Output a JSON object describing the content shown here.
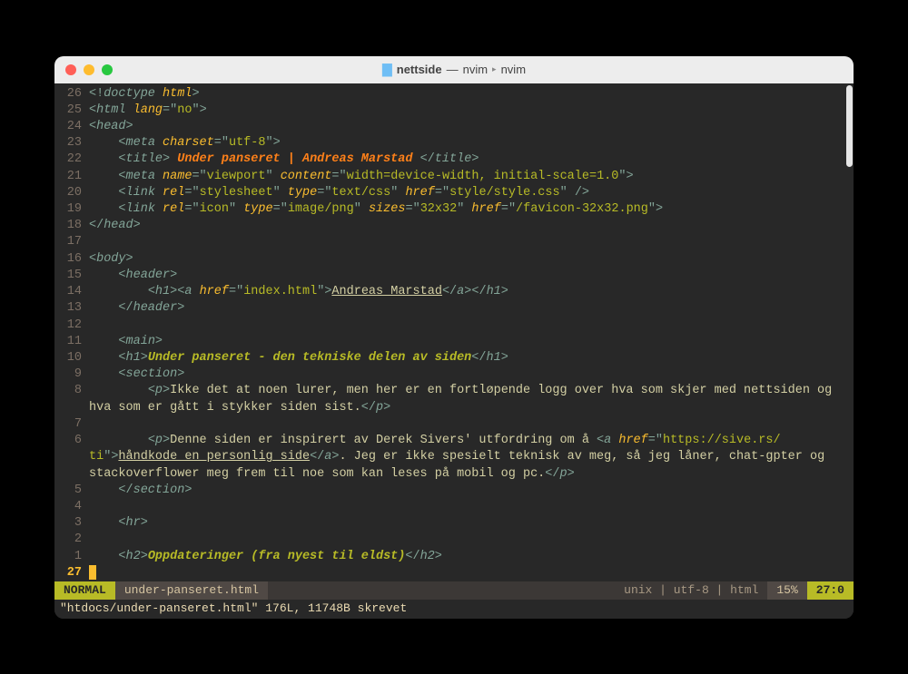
{
  "title": {
    "folder": "nettside",
    "proc": "nvim",
    "sub": "nvim"
  },
  "linenos": {
    "l0": "26",
    "l1": "25",
    "l2": "24",
    "l3": "23",
    "l4": "22",
    "l5": "21",
    "l6": "20",
    "l7": "19",
    "l8": "18",
    "l9": "17",
    "l10": "16",
    "l11": "15",
    "l12": "14",
    "l13": "13",
    "l14": "12",
    "l15": "11",
    "l16": "10",
    "l17": "9",
    "l18": "8",
    "l19": "7",
    "l20": "6",
    "l21": "5",
    "l22": "4",
    "l23": "3",
    "l24": "2",
    "l25": "1",
    "cur": "27"
  },
  "code": {
    "doctype_open": "<!",
    "doctype": "doctype",
    "html_kw": "html",
    "doctype_close": ">",
    "open": "<",
    "close": ">",
    "slash_open": "</",
    "self_close": "/>",
    "eq": "=",
    "q": "\"",
    "t_html": "html",
    "t_head": "head",
    "t_meta": "meta",
    "t_title": "title",
    "t_link": "link",
    "t_body": "body",
    "t_header": "header",
    "t_h1": "h1",
    "t_a": "a",
    "t_main": "main",
    "t_section": "section",
    "t_p": "p",
    "t_hr": "hr",
    "t_h2": "h2",
    "a_lang": "lang",
    "v_lang": "no",
    "a_charset": "charset",
    "v_charset": "utf-8",
    "txt_title": " Under panseret | Andreas Marstad ",
    "a_name": "name",
    "v_viewport": "viewport",
    "a_content": "content",
    "v_vpcont": "width=device-width, initial-scale=1.0",
    "a_rel": "rel",
    "v_stylesheet": "stylesheet",
    "a_type": "type",
    "v_textcss": "text/css",
    "a_href": "href",
    "v_stylehref": "style/style.css",
    "v_icon": "icon",
    "v_imgpng": "image/png",
    "a_sizes": "sizes",
    "v_sizes": "32x32",
    "v_favicon": "/favicon-32x32.png",
    "v_index": "index.html",
    "txt_am": "Andreas Marstad",
    "txt_h1": "Under panseret - den tekniske delen av siden",
    "p1_a": "Ikke det at noen lurer, men her er en fortløpende logg over hva som skjer med nettsiden og ",
    "p1_b": "hva som er gått i stykker siden sist.",
    "p2_a": "Denne siden er inspirert av Derek Sivers' utfordring om å ",
    "v_sivers": "https://sive.rs/",
    "p2_b": "ti",
    "p2_link": "håndkode en personlig side",
    "p2_c": ". Jeg er ikke spesielt teknisk av meg, så jeg låner, chat-gpter og ",
    "p2_d": "stackoverflower meg frem til noe som kan leses på mobil og pc.",
    "txt_h2": "Oppdateringer (fra nyest til eldst)",
    "ind1": "    ",
    "ind2": "        ",
    "ind3": "            "
  },
  "status": {
    "mode": "NORMAL",
    "file": "under-panseret.html",
    "filetype": "unix | utf-8 | html",
    "percent": "15%",
    "pos": "27:0"
  },
  "message": "\"htdocs/under-panseret.html\" 176L, 11748B skrevet"
}
